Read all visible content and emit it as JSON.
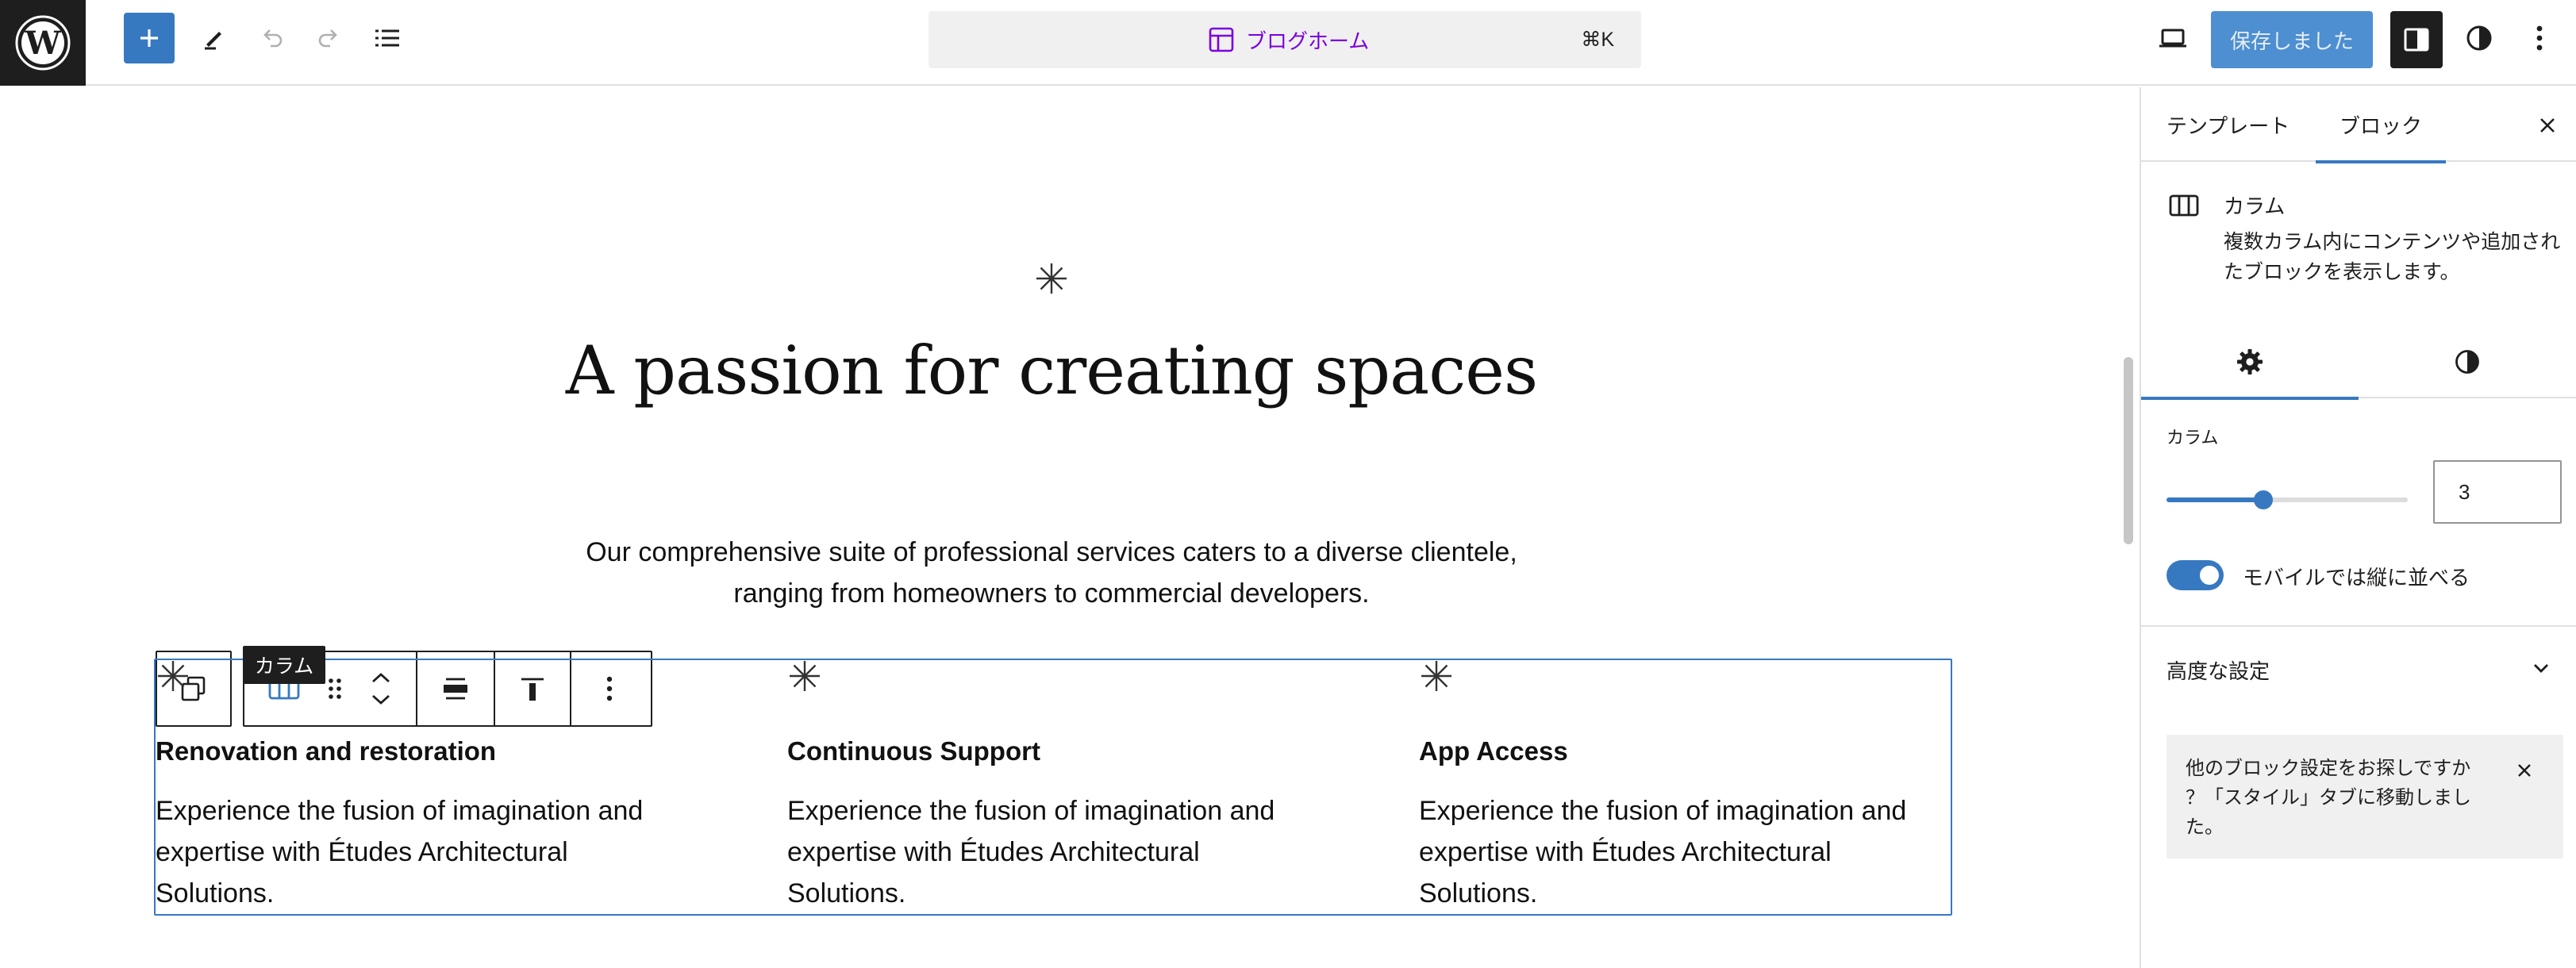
{
  "topbar": {
    "logo": "wordpress-logo",
    "add_icon": "plus-icon",
    "tools": [
      "pencil-icon",
      "undo-icon",
      "redo-icon",
      "list-view-icon"
    ],
    "command": {
      "icon": "layout-icon",
      "title": "ブログホーム",
      "shortcut": "⌘K"
    },
    "device_icon": "laptop-icon",
    "save_label": "保存しました",
    "settings_icon": "sidebar-icon",
    "styles_icon": "half-circle-icon",
    "options_icon": "kebab-icon",
    "accent_color": "#3779c1"
  },
  "canvas": {
    "hero_title": "A passion for creating spaces",
    "hero_desc_line1": "Our comprehensive suite of professional services caters to a diverse clientele,",
    "hero_desc_line2": "ranging from homeowners to commercial developers.",
    "tooltip": "カラム",
    "columns": [
      {
        "title": "Renovation and restoration",
        "line1": "Experience the fusion of imagination and",
        "line2": "expertise with Études Architectural",
        "line3": "Solutions."
      },
      {
        "title": "Continuous Support",
        "line1": "Experience the fusion of imagination and",
        "line2": "expertise with Études Architectural",
        "line3": "Solutions."
      },
      {
        "title": "App Access",
        "line1": "Experience the fusion of imagination and",
        "line2": "expertise with Études Architectural",
        "line3": "Solutions."
      }
    ]
  },
  "sidebar": {
    "tab_template": "テンプレート",
    "tab_block": "ブロック",
    "block_name": "カラム",
    "block_desc": "複数カラム内にコンテンツや追加されたブロックを表示します。",
    "columns_label": "カラム",
    "columns_value": "3",
    "columns_slider_fraction": 0.4,
    "stack_on_mobile_label": "モバイルでは縦に並べる",
    "stack_on_mobile": true,
    "advanced_label": "高度な設定",
    "notice_line1": "他のブロック設定をお探しですか",
    "notice_line2": "？「スタイル」タブに移動しまし",
    "notice_line3": "た。"
  }
}
